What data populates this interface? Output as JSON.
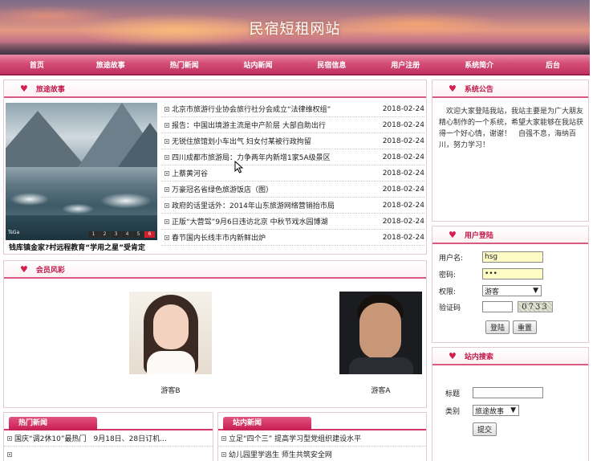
{
  "site_title": "民宿短租网站",
  "nav": [
    "首页",
    "旅途故事",
    "热门新闻",
    "站内新闻",
    "民宿信息",
    "用户注册",
    "系统简介",
    "后台"
  ],
  "travel": {
    "title": "旅途故事",
    "caption": "钱库镇金家?村远程教育“学用之星”受肯定",
    "photo_logo": "TsGa",
    "pager": [
      "1",
      "2",
      "3",
      "4",
      "5",
      "6"
    ],
    "news": [
      {
        "title": "北京市旅游行业协会旅行社分会成立“法律维权组”",
        "date": "2018-02-24"
      },
      {
        "title": "报告：中国出境游主流是中产阶层 大部自助出行",
        "date": "2018-02-24"
      },
      {
        "title": "无锐住旅馆划小车出气 妇女付某被行政拘留",
        "date": "2018-02-24"
      },
      {
        "title": "四川成都市旅游局：力争两年内新增1家5A级景区",
        "date": "2018-02-24"
      },
      {
        "title": "上蔡黄河谷",
        "date": "2018-02-24"
      },
      {
        "title": "万豪冠名省绿色旅游饭店（图）",
        "date": "2018-02-24"
      },
      {
        "title": "政府的话里话外：2014年山东旅游网络营销抬市局",
        "date": "2018-02-24"
      },
      {
        "title": "正版“大营驾”9月6日违访北京 中秋节戏水园博湖",
        "date": "2018-02-24"
      },
      {
        "title": "春节国内长线丰市内新鲜出炉",
        "date": "2018-02-24"
      }
    ]
  },
  "member": {
    "title": "会员风彩",
    "people": [
      {
        "name": "游客B"
      },
      {
        "name": "游客A"
      }
    ]
  },
  "hot_news": {
    "title": "热门新闻",
    "items": [
      "国庆“调2休10”最热门　9月18日、28日订机...",
      ""
    ]
  },
  "site_news": {
    "title": "站内新闻",
    "items": [
      "立足“四个三” 提高学习型党组织建设水平",
      "幼儿园里学逃生 师生共筑安全网"
    ]
  },
  "notice": {
    "title": "系统公告",
    "text": "欢迎大家登陆我站，我站主要是为广大朋友精心制作的一个系统，希望大家能够在我站获得一个好心情，谢谢！　自强不息，海纳百川，努力学习！"
  },
  "login": {
    "title": "用户登陆",
    "user_label": "用户名:",
    "user_value": "hsg",
    "pwd_label": "密码:",
    "pwd_value": "•••",
    "role_label": "权限:",
    "role_value": "游客",
    "captcha_label": "验证码",
    "captcha_code": "0733",
    "login_btn": "登陆",
    "reset_btn": "重置"
  },
  "search": {
    "title": "站内搜索",
    "title_label": "标题",
    "cat_label": "类别",
    "cat_value": "旅途故事",
    "submit": "提交"
  },
  "colors": {
    "accent": "#c8235a",
    "nav": "#d44d78",
    "input_highlight": "#fefbc4"
  }
}
